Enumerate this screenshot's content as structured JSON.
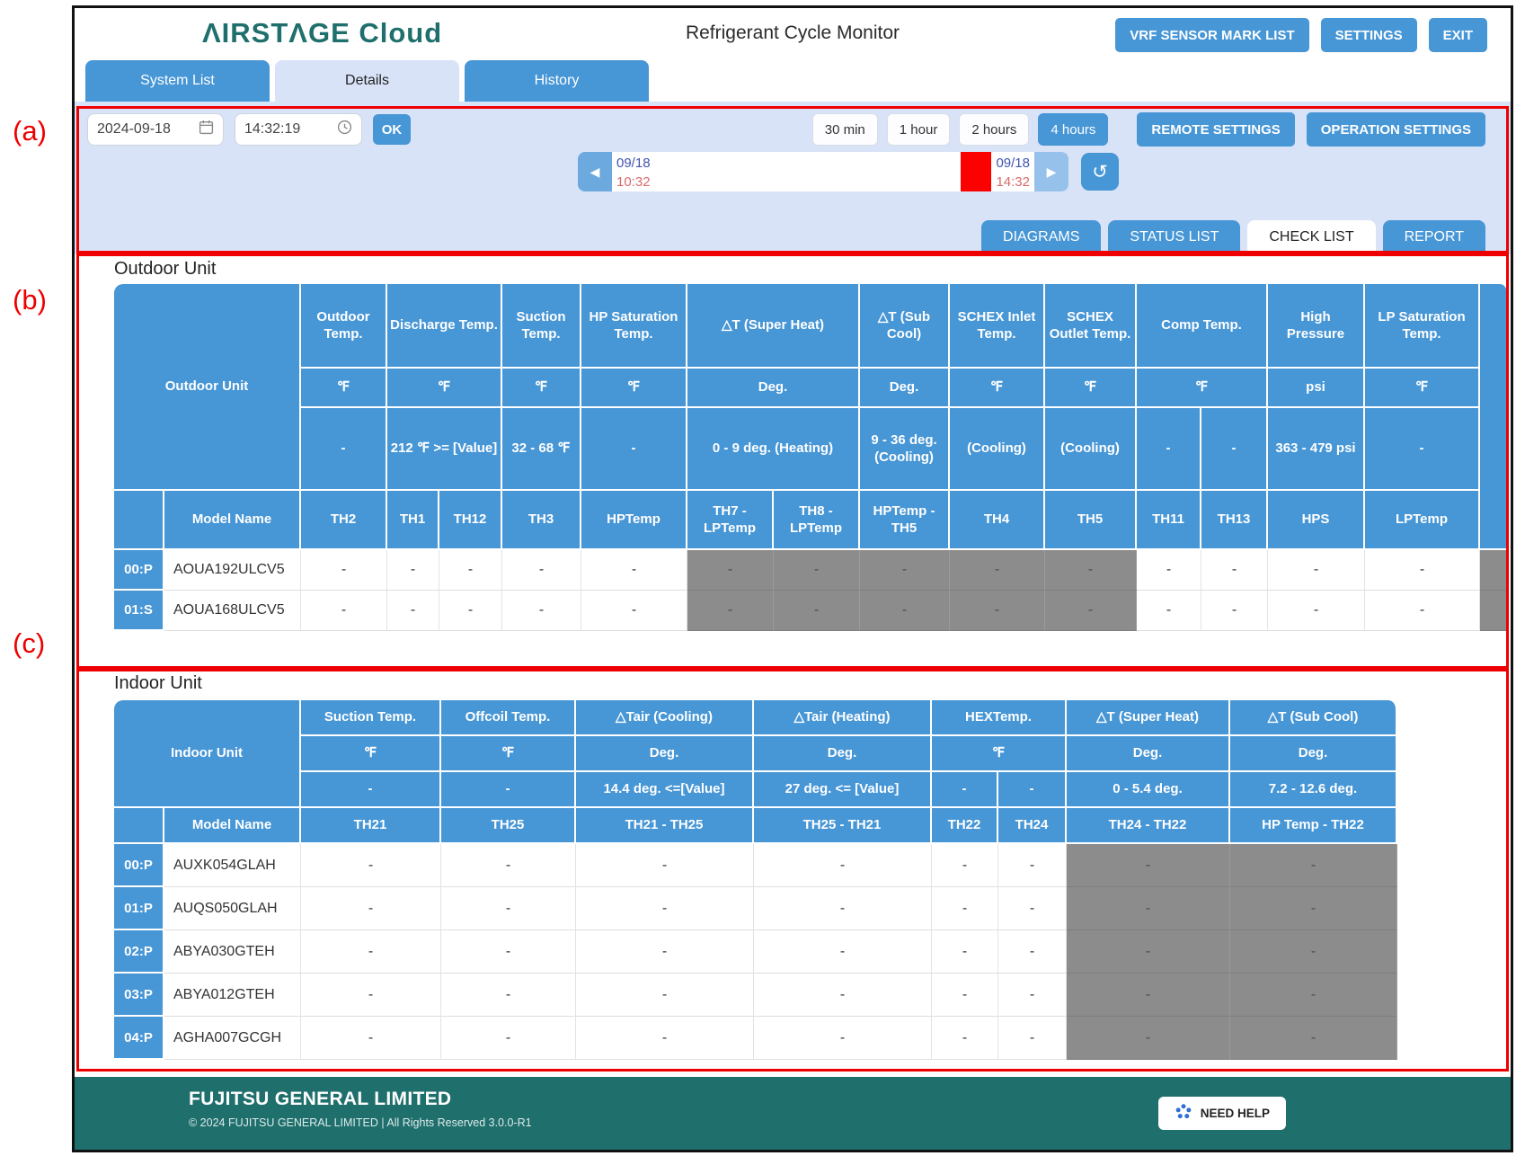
{
  "annotations": {
    "a": "(a)",
    "b": "(b)",
    "c": "(c)"
  },
  "header": {
    "logo": "ΛIRSTΛGE Cloud",
    "title": "Refrigerant Cycle Monitor",
    "vrf_button": "VRF SENSOR MARK LIST",
    "settings_button": "SETTINGS",
    "exit_button": "EXIT"
  },
  "nav_tabs": {
    "system_list": "System List",
    "details": "Details",
    "history": "History"
  },
  "controls": {
    "date": "2024-09-18",
    "time": "14:32:19",
    "ok": "OK",
    "range_30min": "30 min",
    "range_1hour": "1 hour",
    "range_2hours": "2 hours",
    "range_4hours": "4 hours",
    "active_range": "4 hours",
    "remote_settings": "REMOTE SETTINGS",
    "operation_settings": "OPERATION SETTINGS",
    "timeline": {
      "start_date": "09/18",
      "start_time": "10:32",
      "end_date": "09/18",
      "end_time": "14:32"
    },
    "view_tabs": {
      "diagrams": "DIAGRAMS",
      "status_list": "STATUS LIST",
      "check_list": "CHECK LIST",
      "report": "REPORT"
    },
    "active_view": "CHECK LIST"
  },
  "outdoor": {
    "title": "Outdoor Unit",
    "corner": "Outdoor Unit",
    "model_header": "Model Name",
    "cols": {
      "outdoor_temp": {
        "name": "Outdoor Temp.",
        "unit": "℉",
        "range": "-",
        "sensor": "TH2"
      },
      "discharge_temp": {
        "name": "Discharge Temp.",
        "unit": "℉",
        "range": "212 ℉ >= [Value]",
        "sensor1": "TH1",
        "sensor2": "TH12"
      },
      "suction_temp": {
        "name": "Suction Temp.",
        "unit": "℉",
        "range": "32 - 68 ℉",
        "sensor": "TH3"
      },
      "hp_saturation": {
        "name": "HP Saturation Temp.",
        "unit": "℉",
        "range": "-",
        "sensor": "HPTemp"
      },
      "super_heat": {
        "name": "△T (Super Heat)",
        "unit": "Deg.",
        "range": "0 - 9 deg. (Heating)",
        "sensor1": "TH7 - LPTemp",
        "sensor2": "TH8 - LPTemp"
      },
      "sub_cool": {
        "name": "△T (Sub Cool)",
        "unit": "Deg.",
        "range": "9 - 36 deg. (Cooling)",
        "sensor": "HPTemp - TH5"
      },
      "schex_inlet": {
        "name": "SCHEX Inlet Temp.",
        "unit": "℉",
        "range": "(Cooling)",
        "sensor": "TH4"
      },
      "schex_outlet": {
        "name": "SCHEX Outlet Temp.",
        "unit": "℉",
        "range": "(Cooling)",
        "sensor": "TH5"
      },
      "comp_temp": {
        "name": "Comp Temp.",
        "unit": "℉",
        "range1": "-",
        "range2": "-",
        "sensor1": "TH11",
        "sensor2": "TH13"
      },
      "high_pressure": {
        "name": "High Pressure",
        "unit": "psi",
        "range": "363 - 479 psi",
        "sensor": "HPS"
      },
      "lp_saturation": {
        "name": "LP Saturation Temp.",
        "unit": "℉",
        "range": "-",
        "sensor": "LPTemp"
      }
    },
    "rows": [
      {
        "id": "00:P",
        "model": "AOUA192ULCV5",
        "values": [
          "-",
          "-",
          "-",
          "-",
          "-",
          "-",
          "-",
          "-",
          "-",
          "-",
          "-",
          "-",
          "-",
          "-"
        ]
      },
      {
        "id": "01:S",
        "model": "AOUA168ULCV5",
        "values": [
          "-",
          "-",
          "-",
          "-",
          "-",
          "-",
          "-",
          "-",
          "-",
          "-",
          "-",
          "-",
          "-",
          "-"
        ]
      }
    ]
  },
  "indoor": {
    "title": "Indoor Unit",
    "corner": "Indoor Unit",
    "model_header": "Model Name",
    "cols": {
      "suction": {
        "name": "Suction Temp.",
        "unit": "℉",
        "range": "-",
        "sensor": "TH21"
      },
      "offcoil": {
        "name": "Offcoil Temp.",
        "unit": "℉",
        "range": "-",
        "sensor": "TH25"
      },
      "tair_cooling": {
        "name": "△Tair (Cooling)",
        "unit": "Deg.",
        "range": "14.4 deg. <=[Value]",
        "sensor": "TH21 - TH25"
      },
      "tair_heating": {
        "name": "△Tair (Heating)",
        "unit": "Deg.",
        "range": "27 deg. <= [Value]",
        "sensor": "TH25 - TH21"
      },
      "hextemp": {
        "name": "HEXTemp.",
        "unit": "℉",
        "range1": "-",
        "range2": "-",
        "sensor1": "TH22",
        "sensor2": "TH24"
      },
      "super_heat": {
        "name": "△T (Super Heat)",
        "unit": "Deg.",
        "range": "0 - 5.4 deg.",
        "sensor": "TH24 - TH22"
      },
      "sub_cool": {
        "name": "△T (Sub Cool)",
        "unit": "Deg.",
        "range": "7.2 - 12.6 deg.",
        "sensor": "HP Temp - TH22"
      }
    },
    "rows": [
      {
        "id": "00:P",
        "model": "AUXK054GLAH",
        "values": [
          "-",
          "-",
          "-",
          "-",
          "-",
          "-",
          "-",
          "-"
        ]
      },
      {
        "id": "01:P",
        "model": "AUQS050GLAH",
        "values": [
          "-",
          "-",
          "-",
          "-",
          "-",
          "-",
          "-",
          "-"
        ]
      },
      {
        "id": "02:P",
        "model": "ABYA030GTEH",
        "values": [
          "-",
          "-",
          "-",
          "-",
          "-",
          "-",
          "-",
          "-"
        ]
      },
      {
        "id": "03:P",
        "model": "ABYA012GTEH",
        "values": [
          "-",
          "-",
          "-",
          "-",
          "-",
          "-",
          "-",
          "-"
        ]
      },
      {
        "id": "04:P",
        "model": "AGHA007GCGH",
        "values": [
          "-",
          "-",
          "-",
          "-",
          "-",
          "-",
          "-",
          "-"
        ]
      }
    ]
  },
  "footer": {
    "company": "FUJITSU GENERAL LIMITED",
    "copyright": "© 2024 FUJITSU GENERAL LIMITED | All Rights Reserved 3.0.0-R1",
    "help": "NEED HELP"
  },
  "colors": {
    "accent_blue": "#4796d6",
    "band_blue": "#d9e3f8",
    "teal": "#1f6f6d",
    "marker_red": "#fb0200",
    "gray_cell": "#8c8c8c"
  }
}
